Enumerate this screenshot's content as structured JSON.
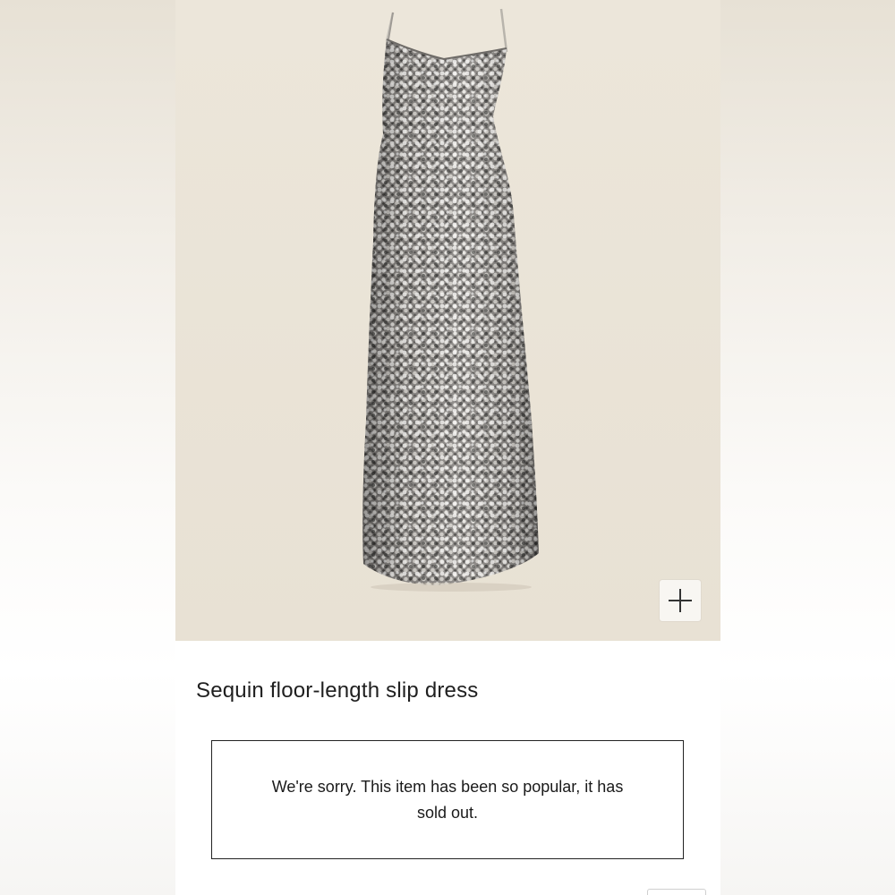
{
  "product": {
    "title": "Sequin floor-length slip dress",
    "image_subject": "silver sequin slip dress",
    "zoom_icon": "plus-icon"
  },
  "availability": {
    "message": "We're sorry. This item has been so popular, it has sold out."
  },
  "colors": {
    "image_background": "#e9e2d6",
    "sequin_silver": "#b5b2ad",
    "text": "#1f1f1f"
  }
}
